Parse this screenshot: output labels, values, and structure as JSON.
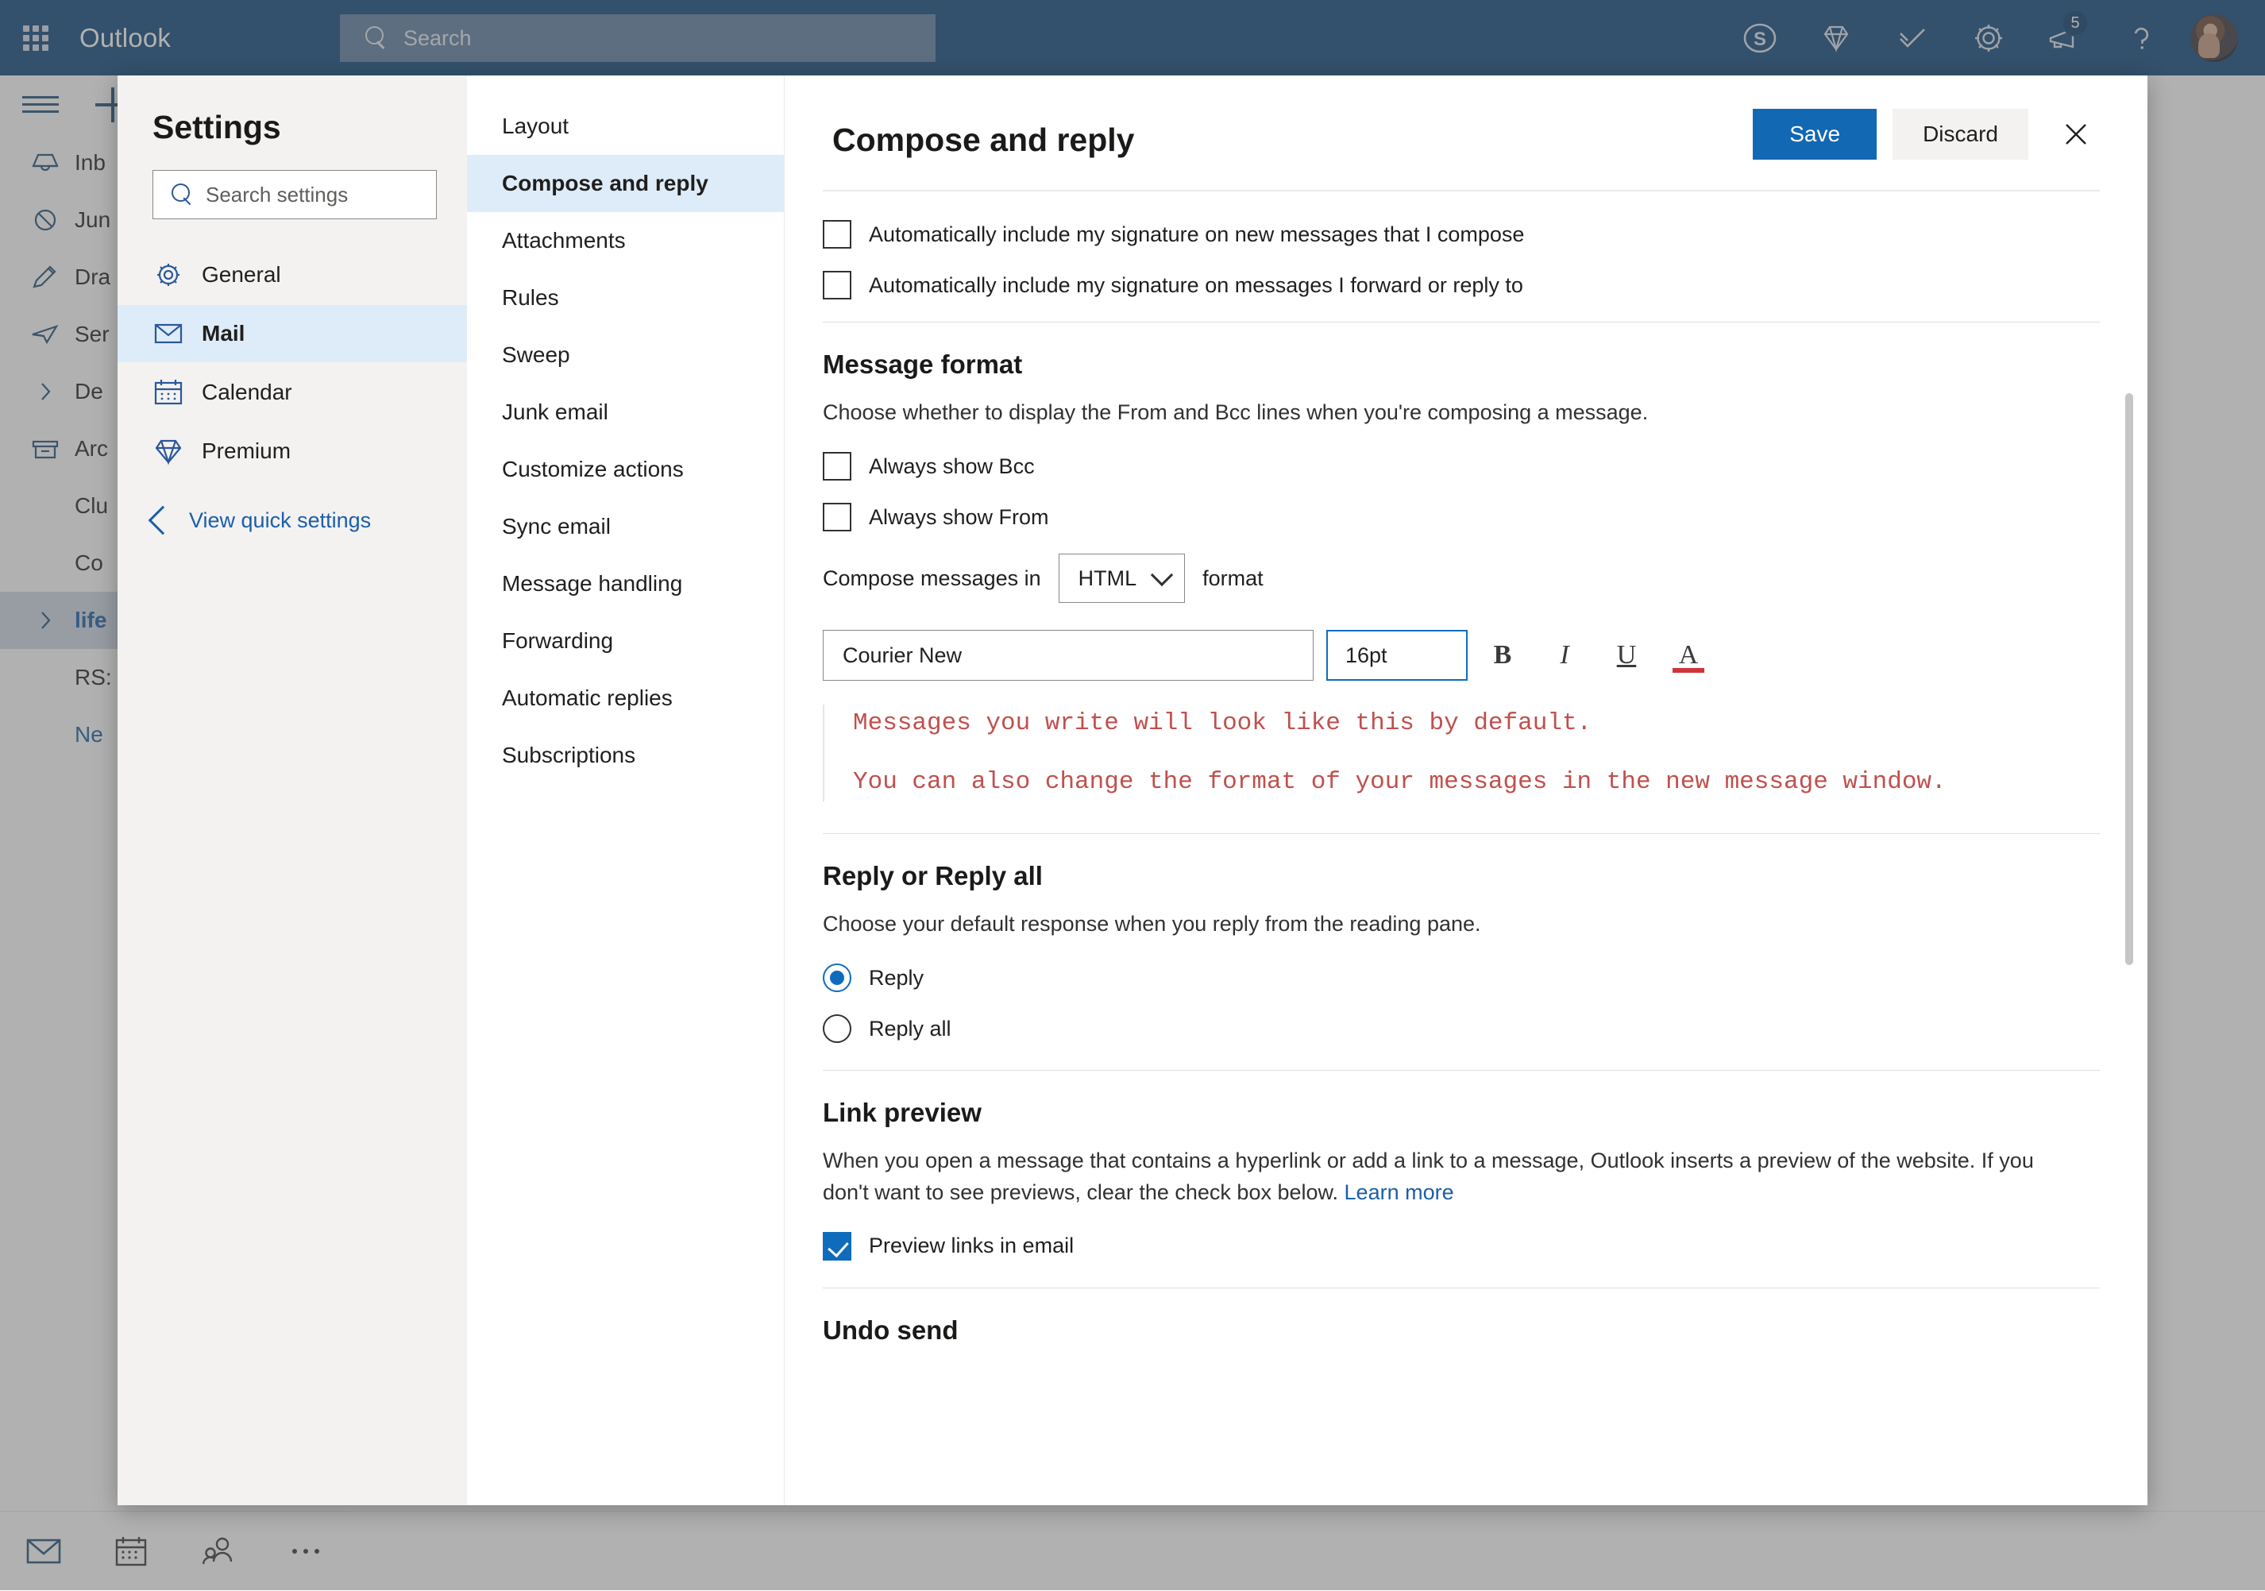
{
  "header": {
    "brand": "Outlook",
    "waffle_icon": "app-launcher-icon",
    "search": {
      "placeholder": "Search",
      "icon": "search-icon"
    },
    "icons": [
      {
        "name": "skype-icon",
        "glyph": "S"
      },
      {
        "name": "premium-diamond-icon",
        "glyph": "diamond"
      },
      {
        "name": "todo-check-icon",
        "glyph": "check"
      },
      {
        "name": "settings-gear-icon",
        "glyph": "gear"
      },
      {
        "name": "notifications-megaphone-icon",
        "glyph": "megaphone",
        "badge": "5"
      },
      {
        "name": "help-question-icon",
        "glyph": "?"
      }
    ],
    "avatar": "user-avatar"
  },
  "mail_app": {
    "hamburger": "menu-icon",
    "new_mail": "new-mail-plus-icon",
    "folders": [
      {
        "label": "Inb",
        "icon": "inbox-icon",
        "selected": false,
        "link": false
      },
      {
        "label": "Jun",
        "icon": "junk-icon",
        "selected": false,
        "link": false
      },
      {
        "label": "Dra",
        "icon": "drafts-pencil-icon",
        "selected": false,
        "link": false
      },
      {
        "label": "Ser",
        "icon": "sent-paperplane-icon",
        "selected": false,
        "link": false
      },
      {
        "label": "De",
        "icon": "chevron-right-icon",
        "selected": false,
        "link": false
      },
      {
        "label": "Arc",
        "icon": "archive-icon",
        "selected": false,
        "link": false
      },
      {
        "label": "Clu",
        "icon": "",
        "selected": false,
        "link": false
      },
      {
        "label": "Co",
        "icon": "",
        "selected": false,
        "link": false
      },
      {
        "label": "life",
        "icon": "chevron-right-icon",
        "selected": true,
        "link": true
      },
      {
        "label": "RS:",
        "icon": "",
        "selected": false,
        "link": false
      },
      {
        "label": "Ne",
        "icon": "",
        "selected": false,
        "link": true
      }
    ],
    "bottom_bar": [
      {
        "name": "mail-nav-icon"
      },
      {
        "name": "calendar-nav-icon"
      },
      {
        "name": "people-nav-icon"
      },
      {
        "name": "more-options-icon"
      }
    ]
  },
  "settings": {
    "title": "Settings",
    "search_placeholder": "Search settings",
    "nav_items": [
      {
        "label": "General",
        "icon": "gear-icon",
        "selected": false
      },
      {
        "label": "Mail",
        "icon": "envelope-icon",
        "selected": true
      },
      {
        "label": "Calendar",
        "icon": "calendar-icon",
        "selected": false
      },
      {
        "label": "Premium",
        "icon": "diamond-icon",
        "selected": false
      }
    ],
    "quick_settings_label": "View quick settings",
    "quick_settings_icon": "chevron-left-icon",
    "categories": [
      {
        "label": "Layout",
        "selected": false
      },
      {
        "label": "Compose and reply",
        "selected": true
      },
      {
        "label": "Attachments",
        "selected": false
      },
      {
        "label": "Rules",
        "selected": false
      },
      {
        "label": "Sweep",
        "selected": false
      },
      {
        "label": "Junk email",
        "selected": false
      },
      {
        "label": "Customize actions",
        "selected": false
      },
      {
        "label": "Sync email",
        "selected": false
      },
      {
        "label": "Message handling",
        "selected": false
      },
      {
        "label": "Forwarding",
        "selected": false
      },
      {
        "label": "Automatic replies",
        "selected": false
      },
      {
        "label": "Subscriptions",
        "selected": false
      }
    ]
  },
  "detail": {
    "title": "Compose and reply",
    "save_label": "Save",
    "discard_label": "Discard",
    "close_icon": "close-icon",
    "signature": {
      "new_messages_label": "Automatically include my signature on new messages that I compose",
      "new_messages_checked": false,
      "forward_reply_label": "Automatically include my signature on messages I forward or reply to",
      "forward_reply_checked": false
    },
    "message_format": {
      "heading": "Message format",
      "description": "Choose whether to display the From and Bcc lines when you're composing a message.",
      "always_show_bcc_label": "Always show Bcc",
      "always_show_bcc_checked": false,
      "always_show_from_label": "Always show From",
      "always_show_from_checked": false,
      "compose_prefix": "Compose messages in",
      "compose_format_value": "HTML",
      "compose_suffix": "format",
      "font_family_value": "Courier New",
      "font_size_value": "16pt",
      "bold_label": "B",
      "italic_label": "I",
      "underline_label": "U",
      "font_color_label": "A",
      "sample_line_1": "Messages you write will look like this by default.",
      "sample_line_2": "You can also change the format of your messages in the new message window.",
      "sample_color": "#c0504d"
    },
    "reply": {
      "heading": "Reply or Reply all",
      "description": "Choose your default response when you reply from the reading pane.",
      "options": [
        {
          "label": "Reply",
          "selected": true
        },
        {
          "label": "Reply all",
          "selected": false
        }
      ]
    },
    "link_preview": {
      "heading": "Link preview",
      "description": "When you open a message that contains a hyperlink or add a link to a message, Outlook inserts a preview of the website. If you don't want to see previews, clear the check box below.",
      "learn_more_label": "Learn more",
      "checkbox_label": "Preview links in email",
      "checkbox_checked": true
    },
    "undo_send": {
      "heading": "Undo send"
    }
  },
  "colors": {
    "header_blue": "#11487d",
    "accent_blue": "#1268b3",
    "selection_blue": "#deecf9",
    "sample_red": "#c0504d"
  }
}
